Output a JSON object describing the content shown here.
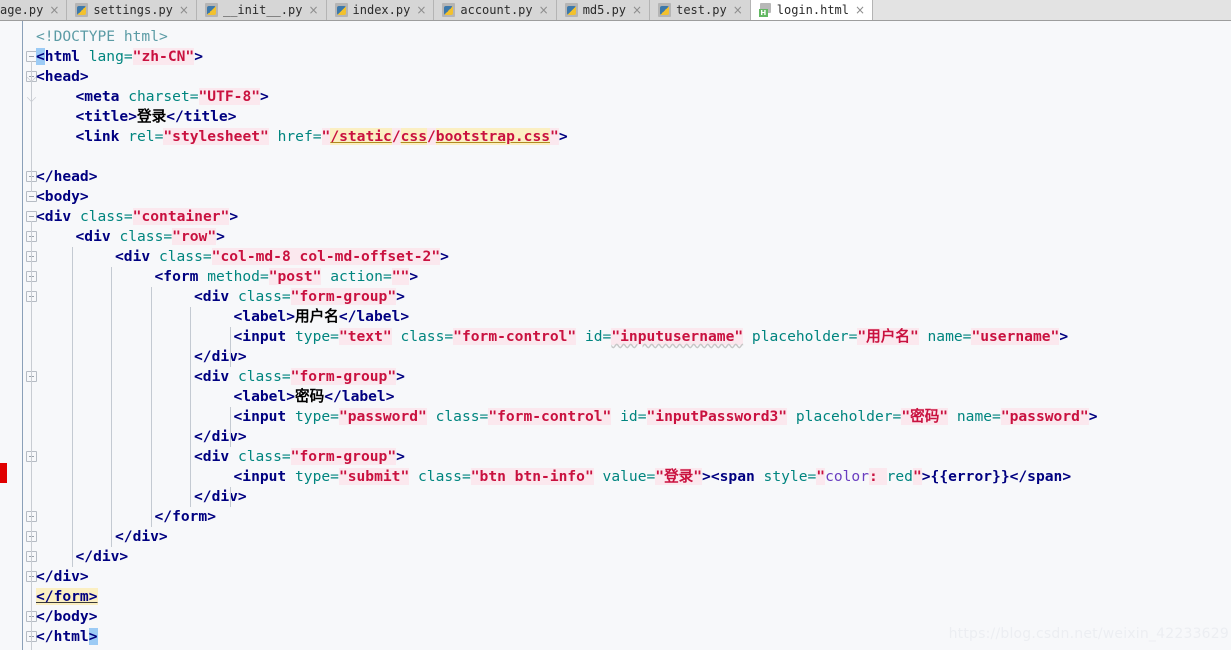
{
  "tabs": [
    {
      "label": "age.py",
      "icon": "python-file-icon",
      "active": false,
      "truncated": true
    },
    {
      "label": "settings.py",
      "icon": "python-file-icon",
      "active": false
    },
    {
      "label": "__init__.py",
      "icon": "python-file-icon",
      "active": false
    },
    {
      "label": "index.py",
      "icon": "python-file-icon",
      "active": false
    },
    {
      "label": "account.py",
      "icon": "python-file-icon",
      "active": false
    },
    {
      "label": "md5.py",
      "icon": "python-file-icon",
      "active": false
    },
    {
      "label": "test.py",
      "icon": "python-file-icon",
      "active": false
    },
    {
      "label": "login.html",
      "icon": "html-file-icon",
      "active": true
    }
  ],
  "tab_close_glyph": "×",
  "editor": {
    "language": "html",
    "font_size_px": 14.6,
    "line_height_px": 20,
    "background": "#f7f8fa",
    "colors": {
      "tag": "#000080",
      "attribute": "#00857f",
      "string": "#c9113f",
      "string_background": "#fbe8ee",
      "doctype": "#5b9ba5",
      "url_highlight": "#fbefc2",
      "css_property": "#6a3ec0",
      "css_value": "#00857f",
      "bracket_match": "#9ccbf5",
      "warning_highlight": "#fbefc2",
      "error_stripe": "#e00000",
      "indent_guide": "#c4cad2",
      "gutter_line": "#8ba0b8"
    },
    "error_marker": {
      "present": true,
      "line_index": 22
    },
    "lines": [
      {
        "n": 1,
        "indent": 0,
        "segs": [
          {
            "t": "doctype",
            "v": "<!DOCTYPE html>"
          }
        ]
      },
      {
        "n": 2,
        "indent": 0,
        "segs": [
          {
            "t": "brmatch",
            "v": "<"
          },
          {
            "t": "tag",
            "v": "html"
          },
          {
            "t": "attr",
            "v": " lang="
          },
          {
            "t": "str",
            "v": "\"zh-CN\""
          },
          {
            "t": "tag",
            "v": ">"
          }
        ]
      },
      {
        "n": 3,
        "indent": 0,
        "segs": [
          {
            "t": "tag",
            "v": "<head>"
          }
        ]
      },
      {
        "n": 4,
        "indent": 1,
        "segs": [
          {
            "t": "tag",
            "v": "<meta"
          },
          {
            "t": "attr",
            "v": " charset="
          },
          {
            "t": "str",
            "v": "\"UTF-8\""
          },
          {
            "t": "tag",
            "v": ">"
          }
        ]
      },
      {
        "n": 5,
        "indent": 1,
        "segs": [
          {
            "t": "tag",
            "v": "<title>"
          },
          {
            "t": "zhtxt",
            "v": "登录"
          },
          {
            "t": "tag",
            "v": "</title>"
          }
        ]
      },
      {
        "n": 6,
        "indent": 1,
        "segs": [
          {
            "t": "tag",
            "v": "<link"
          },
          {
            "t": "attr",
            "v": " rel="
          },
          {
            "t": "str",
            "v": "\"stylesheet\""
          },
          {
            "t": "attr",
            "v": " href="
          },
          {
            "t": "str",
            "v": "\""
          },
          {
            "t": "url",
            "v": "/static"
          },
          {
            "t": "str",
            "v": "/"
          },
          {
            "t": "url",
            "v": "css"
          },
          {
            "t": "str",
            "v": "/"
          },
          {
            "t": "url",
            "v": "bootstrap.css"
          },
          {
            "t": "str",
            "v": "\""
          },
          {
            "t": "tag",
            "v": ">"
          }
        ]
      },
      {
        "n": 7,
        "indent": 0,
        "segs": []
      },
      {
        "n": 8,
        "indent": 0,
        "segs": [
          {
            "t": "tag",
            "v": "</head>"
          }
        ]
      },
      {
        "n": 9,
        "indent": 0,
        "segs": [
          {
            "t": "tag",
            "v": "<body>"
          }
        ]
      },
      {
        "n": 10,
        "indent": 0,
        "segs": [
          {
            "t": "tag",
            "v": "<div"
          },
          {
            "t": "attr",
            "v": " class="
          },
          {
            "t": "str",
            "v": "\"container\""
          },
          {
            "t": "tag",
            "v": ">"
          }
        ]
      },
      {
        "n": 11,
        "indent": 1,
        "segs": [
          {
            "t": "tag",
            "v": "<div"
          },
          {
            "t": "attr",
            "v": " class="
          },
          {
            "t": "str",
            "v": "\"row\""
          },
          {
            "t": "tag",
            "v": ">"
          }
        ]
      },
      {
        "n": 12,
        "indent": 2,
        "segs": [
          {
            "t": "tag",
            "v": "<div"
          },
          {
            "t": "attr",
            "v": " class="
          },
          {
            "t": "str",
            "v": "\"col-md-8 col-md-offset-2\""
          },
          {
            "t": "tag",
            "v": ">"
          }
        ]
      },
      {
        "n": 13,
        "indent": 3,
        "segs": [
          {
            "t": "tag",
            "v": "<form"
          },
          {
            "t": "attr",
            "v": " method="
          },
          {
            "t": "str",
            "v": "\"post\""
          },
          {
            "t": "attr",
            "v": " action="
          },
          {
            "t": "str",
            "v": "\"\""
          },
          {
            "t": "tag",
            "v": ">"
          }
        ]
      },
      {
        "n": 14,
        "indent": 4,
        "segs": [
          {
            "t": "tag",
            "v": "<div"
          },
          {
            "t": "attr",
            "v": " class="
          },
          {
            "t": "str",
            "v": "\"form-group\""
          },
          {
            "t": "tag",
            "v": ">"
          }
        ]
      },
      {
        "n": 15,
        "indent": 5,
        "segs": [
          {
            "t": "tag",
            "v": "<label>"
          },
          {
            "t": "zhtxt",
            "v": "用户名"
          },
          {
            "t": "tag",
            "v": "</label>"
          }
        ]
      },
      {
        "n": 16,
        "indent": 5,
        "segs": [
          {
            "t": "tag",
            "v": "<input"
          },
          {
            "t": "attr",
            "v": " type="
          },
          {
            "t": "str",
            "v": "\"text\""
          },
          {
            "t": "attr",
            "v": " class="
          },
          {
            "t": "str",
            "v": "\"form-control\""
          },
          {
            "t": "attr",
            "v": " id="
          },
          {
            "t": "str-squig",
            "v": "\"inputusername\""
          },
          {
            "t": "attr",
            "v": " placeholder="
          },
          {
            "t": "str",
            "v": "\"用户名\""
          },
          {
            "t": "attr",
            "v": " name="
          },
          {
            "t": "str",
            "v": "\"username\""
          },
          {
            "t": "tag",
            "v": ">"
          }
        ]
      },
      {
        "n": 17,
        "indent": 4,
        "segs": [
          {
            "t": "tag",
            "v": "</div>"
          }
        ]
      },
      {
        "n": 18,
        "indent": 4,
        "segs": [
          {
            "t": "tag",
            "v": "<div"
          },
          {
            "t": "attr",
            "v": " class="
          },
          {
            "t": "str",
            "v": "\"form-group\""
          },
          {
            "t": "tag",
            "v": ">"
          }
        ]
      },
      {
        "n": 19,
        "indent": 5,
        "segs": [
          {
            "t": "tag",
            "v": "<label>"
          },
          {
            "t": "zhtxt",
            "v": "密码"
          },
          {
            "t": "tag",
            "v": "</label>"
          }
        ]
      },
      {
        "n": 20,
        "indent": 5,
        "segs": [
          {
            "t": "tag",
            "v": "<input"
          },
          {
            "t": "attr",
            "v": " type="
          },
          {
            "t": "str",
            "v": "\"password\""
          },
          {
            "t": "attr",
            "v": " class="
          },
          {
            "t": "str",
            "v": "\"form-control\""
          },
          {
            "t": "attr",
            "v": " id="
          },
          {
            "t": "str",
            "v": "\"inputPassword3\""
          },
          {
            "t": "attr",
            "v": " placeholder="
          },
          {
            "t": "str",
            "v": "\"密码\""
          },
          {
            "t": "attr",
            "v": " name="
          },
          {
            "t": "str",
            "v": "\"password\""
          },
          {
            "t": "tag",
            "v": ">"
          }
        ]
      },
      {
        "n": 21,
        "indent": 4,
        "segs": [
          {
            "t": "tag",
            "v": "</div>"
          }
        ]
      },
      {
        "n": 22,
        "indent": 4,
        "segs": [
          {
            "t": "tag",
            "v": "<div"
          },
          {
            "t": "attr",
            "v": " class="
          },
          {
            "t": "str",
            "v": "\"form-group\""
          },
          {
            "t": "tag",
            "v": ">"
          }
        ]
      },
      {
        "n": 23,
        "indent": 5,
        "segs": [
          {
            "t": "tag",
            "v": "<input"
          },
          {
            "t": "attr",
            "v": " type="
          },
          {
            "t": "str",
            "v": "\"submit\""
          },
          {
            "t": "attr",
            "v": " class="
          },
          {
            "t": "str",
            "v": "\"btn btn-info\""
          },
          {
            "t": "attr",
            "v": " value="
          },
          {
            "t": "str",
            "v": "\"登录\""
          },
          {
            "t": "tag",
            "v": "><span"
          },
          {
            "t": "attr",
            "v": " style="
          },
          {
            "t": "str",
            "v": "\""
          },
          {
            "t": "cssprop",
            "v": "color"
          },
          {
            "t": "str",
            "v": ": "
          },
          {
            "t": "cssval",
            "v": "red"
          },
          {
            "t": "str",
            "v": "\""
          },
          {
            "t": "tag",
            "v": ">{{error}}</span>"
          }
        ]
      },
      {
        "n": 24,
        "indent": 4,
        "segs": [
          {
            "t": "tag",
            "v": "</div>"
          }
        ]
      },
      {
        "n": 25,
        "indent": 3,
        "segs": [
          {
            "t": "tag",
            "v": "</form>"
          }
        ]
      },
      {
        "n": 26,
        "indent": 2,
        "segs": [
          {
            "t": "tag",
            "v": "</div>"
          }
        ]
      },
      {
        "n": 27,
        "indent": 1,
        "segs": [
          {
            "t": "tag",
            "v": "</div>"
          }
        ]
      },
      {
        "n": 28,
        "indent": 0,
        "segs": [
          {
            "t": "tag",
            "v": "</div>"
          }
        ]
      },
      {
        "n": 29,
        "indent": 0,
        "segs": [
          {
            "t": "warnhl",
            "v": "</form>"
          }
        ]
      },
      {
        "n": 30,
        "indent": 0,
        "segs": [
          {
            "t": "tag",
            "v": "</body>"
          }
        ]
      },
      {
        "n": 31,
        "indent": 0,
        "segs": [
          {
            "t": "tag",
            "v": "</html"
          },
          {
            "t": "brmatch",
            "v": ">"
          }
        ]
      }
    ]
  },
  "watermark": {
    "text": "https://blog.csdn.net/weixin_42233629"
  }
}
